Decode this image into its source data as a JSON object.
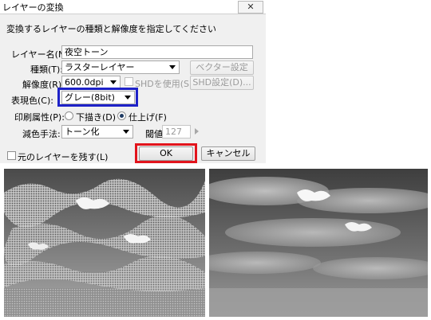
{
  "dialog": {
    "title": "レイヤーの変換",
    "close_symbol": "✕",
    "instruction": "変換するレイヤーの種類と解像度を指定してください",
    "layer_name_label": "レイヤー名(N):",
    "layer_name_value": "夜空トーン",
    "type_label": "種類(T):",
    "type_value": "ラスターレイヤー",
    "vector_settings_button": "ベクター設定(V)...",
    "resolution_label": "解像度(R):",
    "resolution_value": "600.0dpi",
    "shd_use_label": "SHDを使用(S)",
    "shd_settings_button": "SHD設定(D)...",
    "color_label": "表現色(C):",
    "color_value": "グレー(8bit)",
    "print_attr_label": "印刷属性(P):",
    "print_draft_label": "下描き(D)",
    "print_final_label": "仕上げ(F)",
    "print_final_selected": true,
    "reduce_label": "減色手法:",
    "reduce_value": "トーン化",
    "threshold_label": "閾値:",
    "threshold_value": "127",
    "keep_original_label": "元のレイヤーを残す(L)",
    "ok_button": "OK",
    "cancel_button": "キャンセル"
  },
  "highlight_colors": {
    "color_box": "#1e22c8",
    "ok_box": "#e2141c"
  },
  "images": [
    {
      "name": "toned-sky-image",
      "description_icon": "cloud-sky-halftone"
    },
    {
      "name": "gray-sky-image",
      "description_icon": "cloud-sky-gray"
    }
  ]
}
